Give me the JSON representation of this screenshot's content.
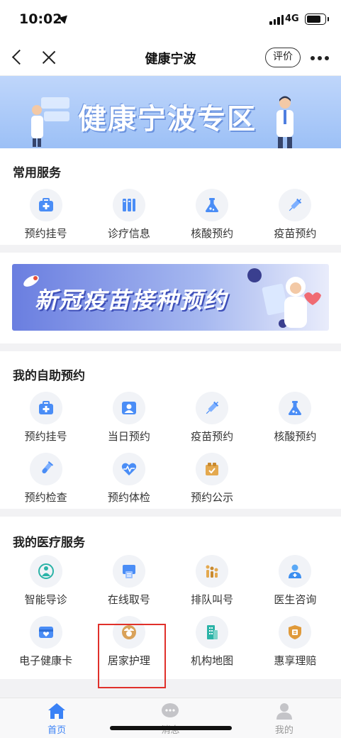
{
  "status": {
    "time": "10:02",
    "network": "4G"
  },
  "nav": {
    "title": "健康宁波",
    "rate": "评价"
  },
  "banner": {
    "text": "健康宁波专区"
  },
  "common": {
    "title": "常用服务",
    "items": [
      {
        "label": "预约挂号",
        "icon": "medical-kit-icon"
      },
      {
        "label": "诊疗信息",
        "icon": "records-icon"
      },
      {
        "label": "核酸预约",
        "icon": "flask-icon"
      },
      {
        "label": "疫苗预约",
        "icon": "syringe-icon"
      }
    ]
  },
  "covid_banner": {
    "text": "新冠疫苗接种预约"
  },
  "self": {
    "title": "我的自助预约",
    "items": [
      {
        "label": "预约挂号",
        "icon": "medical-kit-icon"
      },
      {
        "label": "当日预约",
        "icon": "doctor-card-icon"
      },
      {
        "label": "疫苗预约",
        "icon": "syringe-icon"
      },
      {
        "label": "核酸预约",
        "icon": "flask-icon"
      },
      {
        "label": "预约检查",
        "icon": "test-tube-icon"
      },
      {
        "label": "预约体检",
        "icon": "heart-monitor-icon"
      },
      {
        "label": "预约公示",
        "icon": "notice-icon"
      }
    ]
  },
  "medical": {
    "title": "我的医疗服务",
    "items": [
      {
        "label": "智能导诊",
        "icon": "guide-icon"
      },
      {
        "label": "在线取号",
        "icon": "printer-icon"
      },
      {
        "label": "排队叫号",
        "icon": "queue-icon"
      },
      {
        "label": "医生咨询",
        "icon": "doctor-icon"
      },
      {
        "label": "电子健康卡",
        "icon": "health-card-icon"
      },
      {
        "label": "居家护理",
        "icon": "nurse-icon"
      },
      {
        "label": "机构地图",
        "icon": "building-icon"
      },
      {
        "label": "惠享理赔",
        "icon": "claim-icon"
      }
    ]
  },
  "tabs": [
    {
      "label": "首页",
      "icon": "home-icon"
    },
    {
      "label": "消息",
      "icon": "message-icon"
    },
    {
      "label": "我的",
      "icon": "user-icon"
    }
  ],
  "colors": {
    "accent": "#3b82f6",
    "highlight": "#e0302a"
  }
}
